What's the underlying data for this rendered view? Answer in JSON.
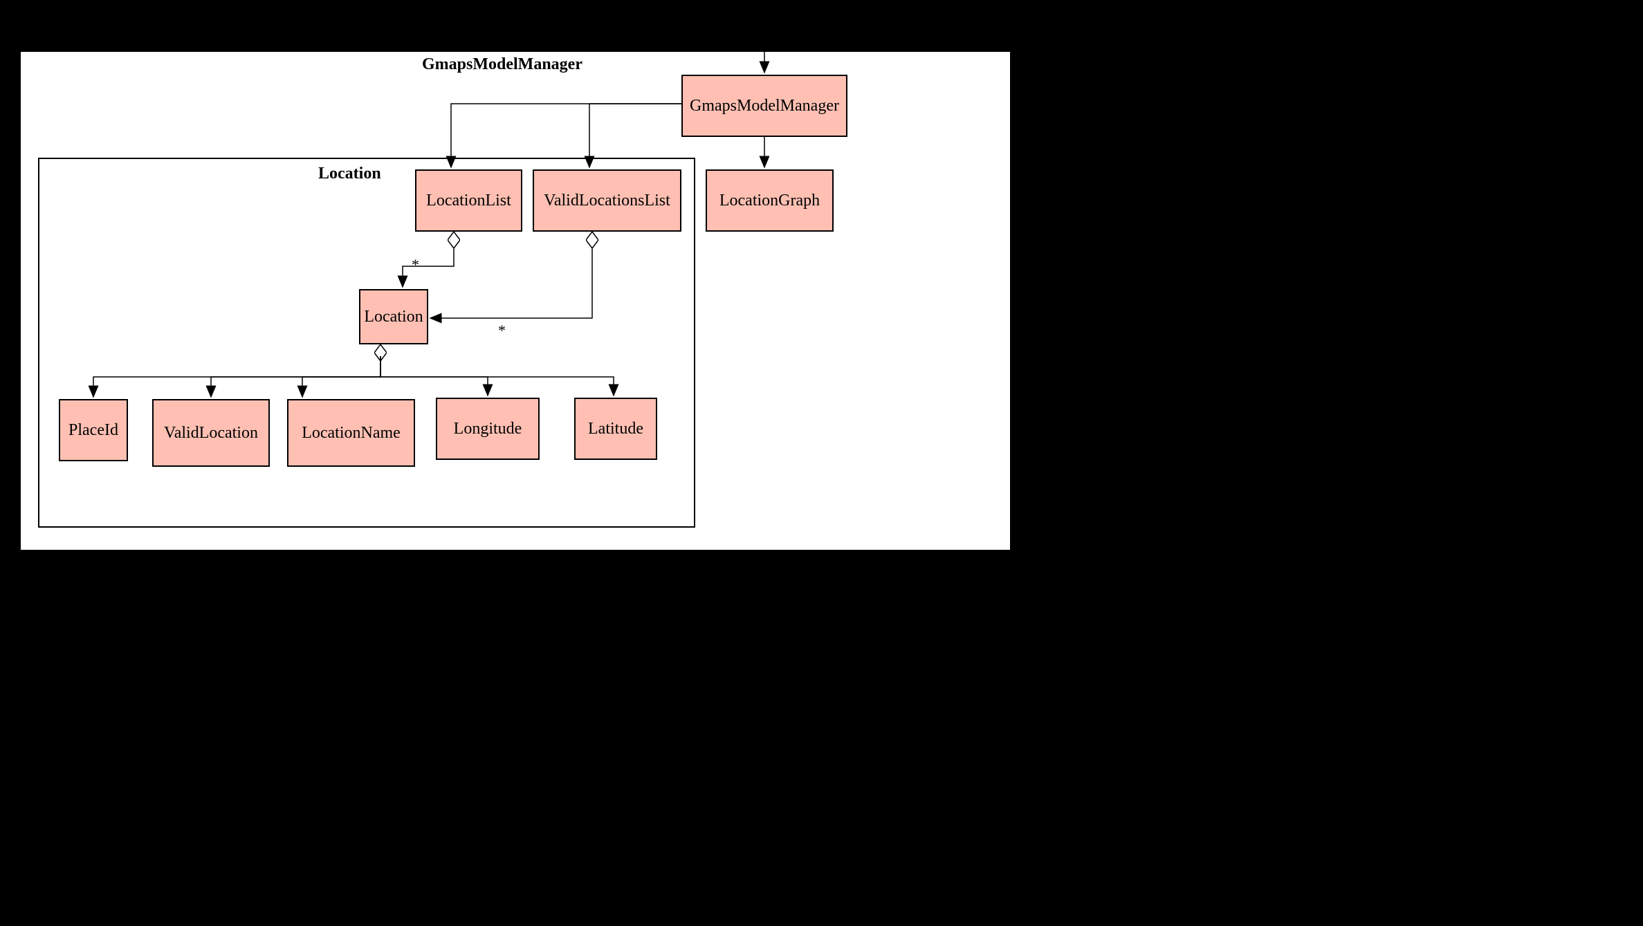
{
  "outer": {
    "title": "GmapsModelManager"
  },
  "inner": {
    "title": "Location"
  },
  "nodes": {
    "gmapsModelManager": "GmapsModelManager",
    "locationGraph": "LocationGraph",
    "locationList": "LocationList",
    "validLocationsList": "ValidLocationsList",
    "location": "Location",
    "placeId": "PlaceId",
    "validLocation": "ValidLocation",
    "locationName": "LocationName",
    "longitude": "Longitude",
    "latitude": "Latitude"
  },
  "multiplicity": {
    "star1": "*",
    "star2": "*"
  },
  "edges": [
    {
      "from": "external",
      "to": "gmapsModelManager",
      "kind": "arrow"
    },
    {
      "from": "gmapsModelManager",
      "to": "locationList",
      "kind": "arrow"
    },
    {
      "from": "gmapsModelManager",
      "to": "validLocationsList",
      "kind": "arrow"
    },
    {
      "from": "gmapsModelManager",
      "to": "locationGraph",
      "kind": "arrow"
    },
    {
      "from": "locationList",
      "to": "location",
      "kind": "aggregation",
      "multiplicity": "*"
    },
    {
      "from": "validLocationsList",
      "to": "location",
      "kind": "aggregation",
      "multiplicity": "*"
    },
    {
      "from": "location",
      "to": "placeId",
      "kind": "aggregation"
    },
    {
      "from": "location",
      "to": "validLocation",
      "kind": "aggregation"
    },
    {
      "from": "location",
      "to": "locationName",
      "kind": "aggregation"
    },
    {
      "from": "location",
      "to": "longitude",
      "kind": "aggregation"
    },
    {
      "from": "location",
      "to": "latitude",
      "kind": "aggregation"
    }
  ]
}
